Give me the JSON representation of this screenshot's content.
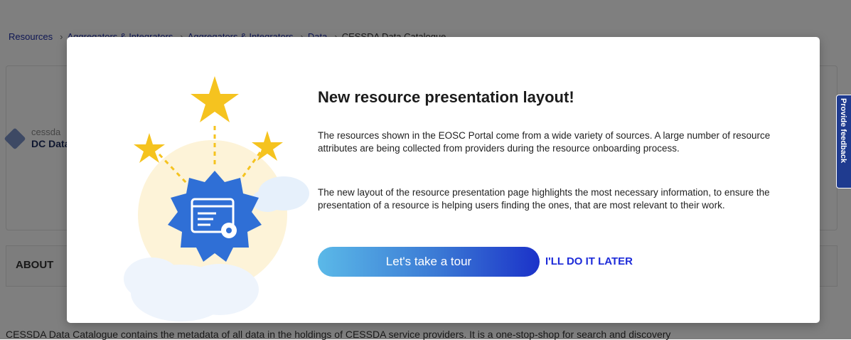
{
  "breadcrumb": {
    "items": [
      "Resources",
      "Aggregators & Integrators",
      "Aggregators & Integrators",
      "Data"
    ],
    "current": "CESSDA Data Catalogue"
  },
  "logo": {
    "line1": "cessda",
    "line2": "DC Data"
  },
  "about": {
    "label": "ABOUT"
  },
  "description": "CESSDA Data Catalogue contains the metadata of all data in the holdings of CESSDA service providers. It is a one-stop-shop for search and discovery",
  "feedback": {
    "label": "Provide feedback"
  },
  "modal": {
    "title": "New resource presentation layout!",
    "paragraph1": "The resources shown in the EOSC Portal come from a wide variety of sources. A large number of resource attributes are being collected from providers during the resource onboarding process.",
    "paragraph2": "The new layout of the resource presentation page highlights the most necessary information, to ensure the presentation of a resource is helping users finding the ones, that are most relevant to their work.",
    "tour_button": "Let's take a tour",
    "later_link": "I'LL DO IT LATER"
  },
  "colors": {
    "overlay": "#7f7f7f",
    "accent": "#1d2bd9",
    "button_gradient_start": "#5bb9e8",
    "button_gradient_end": "#1b32c9",
    "badge_blue": "#2f6fd6",
    "star_yellow": "#f5c31f",
    "feedback_tab": "#1f3b8f"
  },
  "icons": {
    "illustration": "badge-with-window-and-gear",
    "stars": "star-icon",
    "cloud": "cloud-icon"
  }
}
